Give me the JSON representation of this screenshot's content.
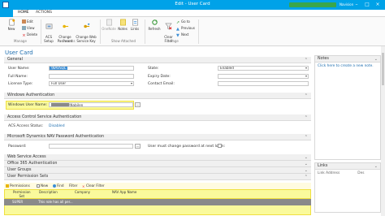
{
  "window": {
    "title": "Edit - User Card",
    "user_name": "Navision",
    "accent": "#00a2e8"
  },
  "ribbon": {
    "tabs": [
      "HOME",
      "ACTIONS"
    ],
    "manage": {
      "new_label": "New",
      "edit_label": "Edit",
      "view_label": "View",
      "delete_label": "Delete",
      "group_label": "Manage"
    },
    "process": {
      "acs_setup": "ACS\nSetup",
      "change_password": "Change\nPassword",
      "change_web_key": "Change Web\nService Key",
      "group_label": "Process"
    },
    "show_attached": {
      "onenote": "OneNote",
      "notes": "Notes",
      "links": "Links",
      "group_label": "Show Attached"
    },
    "page": {
      "refresh": "Refresh",
      "clear_filter": "Clear\nFilter",
      "goto": "Go to",
      "previous": "Previous",
      "next": "Next",
      "group_label": "Page"
    }
  },
  "card": {
    "title": "User Card",
    "general": {
      "header": "General",
      "user_name_label": "User Name:",
      "user_name_value": "\\NAVSQL",
      "full_name_label": "Full Name:",
      "full_name_value": "",
      "license_type_label": "License Type:",
      "license_type_value": "Full User",
      "state_label": "State:",
      "state_value": "Enabled",
      "expiry_label": "Expiry Date:",
      "expiry_value": "",
      "contact_email_label": "Contact Email:",
      "contact_email_value": ""
    },
    "windows_auth": {
      "header": "Windows Authentication",
      "windows_user_label": "Windows User Name:",
      "windows_user_value": "\\Nabilen"
    },
    "acs": {
      "header": "Access Control Service Authentication",
      "status_label": "ACS Access Status:",
      "status_value": "Disabled"
    },
    "nav_password": {
      "header": "Microsoft Dynamics NAV Password Authentication",
      "password_label": "Password:",
      "must_change_label": "User must change password at next login:"
    },
    "collapsed_sections": [
      "Web Service Access",
      "Office 365 Authentication",
      "User Groups",
      "User Permission Sets"
    ]
  },
  "subpage": {
    "toolbar": [
      "Permissions",
      "New",
      "Find",
      "Filter",
      "Clear Filter"
    ],
    "columns": [
      "Permission\nSet",
      "Description",
      "Company",
      "NAV App Name"
    ],
    "rows": [
      {
        "permission_set": "SUPER",
        "description": "This role has all per...",
        "company": "",
        "app": ""
      }
    ]
  },
  "factboxes": {
    "notes": {
      "header": "Notes",
      "link": "Click here to create a new note."
    },
    "links": {
      "header": "Links",
      "column": "Link Address",
      "column2": "Des"
    }
  }
}
